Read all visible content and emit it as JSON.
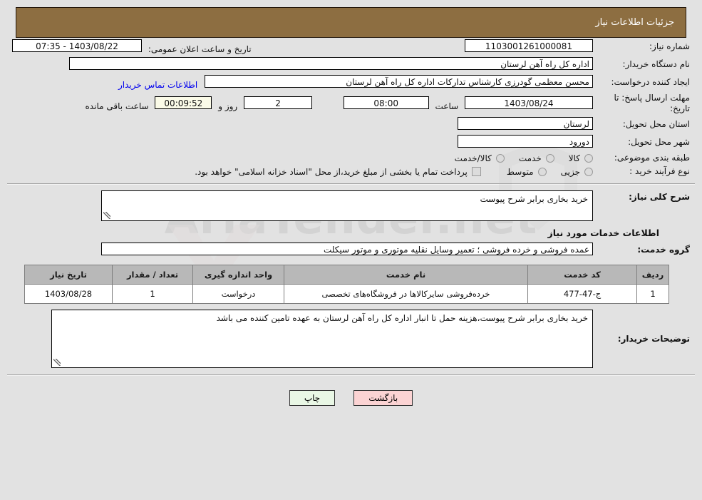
{
  "header": {
    "title": "جزئیات اطلاعات نیاز"
  },
  "colors": {
    "header_bar": "#8d6e41",
    "page_bg": "#e2e2e2",
    "link": "#0000ee",
    "table_header": "#b8b8b8",
    "countdown_bg": "#fbfbe8",
    "print_button": "#e9f7e5",
    "back_button": "#fbd3d3"
  },
  "watermark": {
    "text": "AriaTender.net"
  },
  "form": {
    "need_number_label": "شماره نیاز:",
    "need_number_value": "1103001261000081",
    "public_announce_label": "تاریخ و ساعت اعلان عمومی:",
    "public_announce_value": "1403/08/22 - 07:35",
    "buyer_org_label": "نام دستگاه خریدار:",
    "buyer_org_value": "اداره کل راه آهن لرستان",
    "creator_label": "ایجاد کننده درخواست:",
    "creator_value": "محسن معظمی گودرزی کارشناس تدارکات اداره کل راه آهن لرستان",
    "contact_link": "اطلاعات تماس خریدار",
    "deadline_label": "مهلت ارسال پاسخ: تا تاریخ:",
    "deadline_date": "1403/08/24",
    "deadline_hour_label": "ساعت",
    "deadline_hour_value": "08:00",
    "remaining_days": "2",
    "days_and_label": "روز و",
    "remaining_time": "00:09:52",
    "remaining_suffix": "ساعت باقی مانده",
    "province_label": "استان محل تحویل:",
    "province_value": "لرستان",
    "city_label": "شهر محل تحویل:",
    "city_value": "دورود",
    "classification_label": "طبقه بندی موضوعی:",
    "classification_options": [
      {
        "label": "کالا",
        "selected": false
      },
      {
        "label": "خدمت",
        "selected": false
      },
      {
        "label": "کالا/خدمت",
        "selected": false
      }
    ],
    "process_type_label": "نوع فرآیند خرید :",
    "process_type_options": [
      {
        "label": "جزیی",
        "selected": false
      },
      {
        "label": "متوسط",
        "selected": false
      }
    ],
    "treasury_note": "پرداخت تمام یا بخشی از مبلغ خرید،از محل \"اسناد خزانه اسلامی\" خواهد بود.",
    "treasury_checked": false
  },
  "need_summary": {
    "label": "شرح کلی نیاز:",
    "value": "خرید بخاری برابر شرح پیوست"
  },
  "services_section": {
    "heading": "اطلاعات خدمات مورد نیاز",
    "service_group_label": "گروه خدمت:",
    "service_group_value": "عمده فروشی و خرده فروشی ؛ تعمیر وسایل نقلیه موتوری و موتور سیکلت"
  },
  "table": {
    "columns": [
      "ردیف",
      "کد خدمت",
      "نام خدمت",
      "واحد اندازه گیری",
      "تعداد / مقدار",
      "تاریخ نیاز"
    ],
    "rows": [
      {
        "row": "1",
        "code": "ج-47-477",
        "name": "خرده‌فروشی سایرکالاها در فروشگاه‌های تخصصی",
        "unit": "درخواست",
        "quantity": "1",
        "need_date": "1403/08/28"
      }
    ]
  },
  "buyer_notes": {
    "label": "توضیحات خریدار:",
    "value": "خرید بخاری برابر شرح پیوست،هزینه حمل تا انبار اداره کل راه آهن لرستان به عهده تامین کننده می باشد"
  },
  "buttons": {
    "print": "چاپ",
    "back": "بازگشت"
  }
}
